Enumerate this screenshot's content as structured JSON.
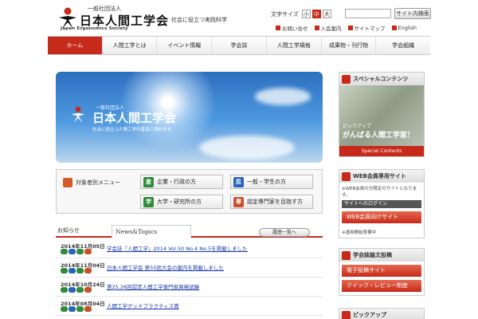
{
  "header": {
    "org_prefix": "一般社団法人",
    "org_name": "日本人間工学会",
    "org_name_en": "Japan Ergonomics Society",
    "tagline": "社会に役立つ実践科学",
    "font_size_label": "文字サイズ",
    "font_sizes": [
      "小",
      "中",
      "大"
    ],
    "font_size_active": 1,
    "search_button": "サイト内検索",
    "util_links": [
      "お問い合せ",
      "入会案内",
      "サイトマップ",
      "English"
    ]
  },
  "nav": {
    "items": [
      "ホーム",
      "人間工学とは",
      "イベント情報",
      "学会誌",
      "人間工学規格",
      "成果物・刊行物",
      "学会組織"
    ],
    "active": 0
  },
  "hero": {
    "org_prefix": "一般社団法人",
    "org_name": "日本人間工学会",
    "tagline": "社会に役立つ人間工学の普及に努めます。"
  },
  "target_menu": {
    "label": "対象者別メニュー",
    "buttons": [
      {
        "badge": "産",
        "label": "企業・行政の方",
        "color": "#2f8a3a"
      },
      {
        "badge": "民",
        "label": "一般・学生の方",
        "color": "#2a63b8"
      },
      {
        "badge": "学",
        "label": "大学・研究所の方",
        "color": "#2f8a3a"
      },
      {
        "badge": "専",
        "label": "認定専門家を目指す方",
        "color": "#c8502a"
      }
    ]
  },
  "news": {
    "tab_notice": "お知らせ",
    "tab_news": "News&Topics",
    "history_button": "履歴一覧へ",
    "items": [
      {
        "date": "2014年11月05日",
        "title": "学会誌『人間工学』2014 Vol.50 No.4 No.5を掲載しました"
      },
      {
        "date": "2014年11月04日",
        "title": "日本人間工学会 第55回大会の案内を掲載しました"
      },
      {
        "date": "2014年10月24日",
        "title": "第25,26回認定人間工学専門家資格試験"
      },
      {
        "date": "2014年08月04日",
        "title": "人間工学グッドプラクティス賞"
      }
    ]
  },
  "sidebar": {
    "special": {
      "title": "スペシャルコンテンツ",
      "caption": "ピックアップ",
      "caption2": "がんばる人間工学家！",
      "bar": "Special Contents"
    },
    "members": {
      "title": "WEB会員専用サイト",
      "note": "※WEB会員の方限定のサイトとなります。",
      "login": "サイトへのログイン",
      "button": "WEB会員向けサイト",
      "note2": "※運用開始準備中"
    },
    "submission": {
      "title": "学会誌論文投稿",
      "buttons": [
        "電子投稿サイト",
        "クイック・レビュー制度"
      ]
    },
    "pickup": {
      "title": "ピックアップ"
    }
  },
  "colors": {
    "accent": "#c62a1a",
    "link": "#1a3aa8"
  }
}
